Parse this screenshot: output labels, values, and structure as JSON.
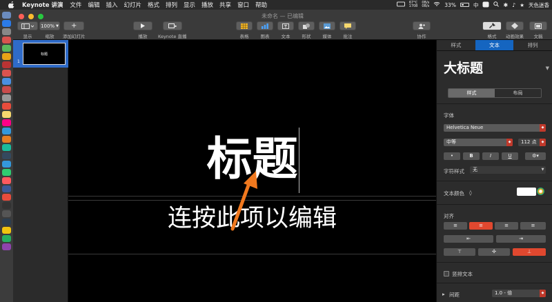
{
  "menubar": {
    "app_name": "Keynote 讲演",
    "items": [
      "文件",
      "编辑",
      "插入",
      "幻灯片",
      "格式",
      "排列",
      "显示",
      "播放",
      "共享",
      "窗口",
      "帮助"
    ],
    "temp": "67°C",
    "rpm": "1708",
    "net_up": "0B/s",
    "net_down": "0B/s",
    "battery": "33%",
    "input_method": "中",
    "user": "天色迷香"
  },
  "window": {
    "title": "未命名 — 已编辑"
  },
  "toolbar": {
    "view_label": "显示",
    "zoom_value": "100%",
    "zoom_label": "缩放",
    "add_slide_label": "添加幻灯片",
    "play_label": "播放",
    "live_label": "Keynote 直播",
    "table_label": "表格",
    "chart_label": "图表",
    "text_label": "文本",
    "shape_label": "形状",
    "media_label": "媒体",
    "comment_label": "批注",
    "collab_label": "协作",
    "format_label": "格式",
    "animate_label": "动画效果",
    "document_label": "文稿"
  },
  "navigator": {
    "slide_number": "1",
    "thumb_text": "标题"
  },
  "slide": {
    "title": "标题",
    "subtitle": "连按此项以编辑"
  },
  "inspector": {
    "tabs": [
      "样式",
      "文本",
      "排列"
    ],
    "active_tab": "文本",
    "paragraph_style": "大标题",
    "seg_style": "样式",
    "seg_layout": "布局",
    "font_label": "字体",
    "font_name": "Helvetica Neue",
    "font_weight": "中等",
    "font_size": "112 点",
    "bold": "B",
    "italic": "I",
    "underline": "U",
    "char_style_label": "字符样式",
    "char_style_value": "无",
    "text_color_label": "文本颜色",
    "align_label": "对齐",
    "vertical_text_label": "竖排文本",
    "spacing_label": "间距",
    "spacing_value": "1.0 - 倍"
  },
  "colors": {
    "accent": "#1565c0",
    "highlight": "#e0482f",
    "arrow": "#f0781e"
  }
}
